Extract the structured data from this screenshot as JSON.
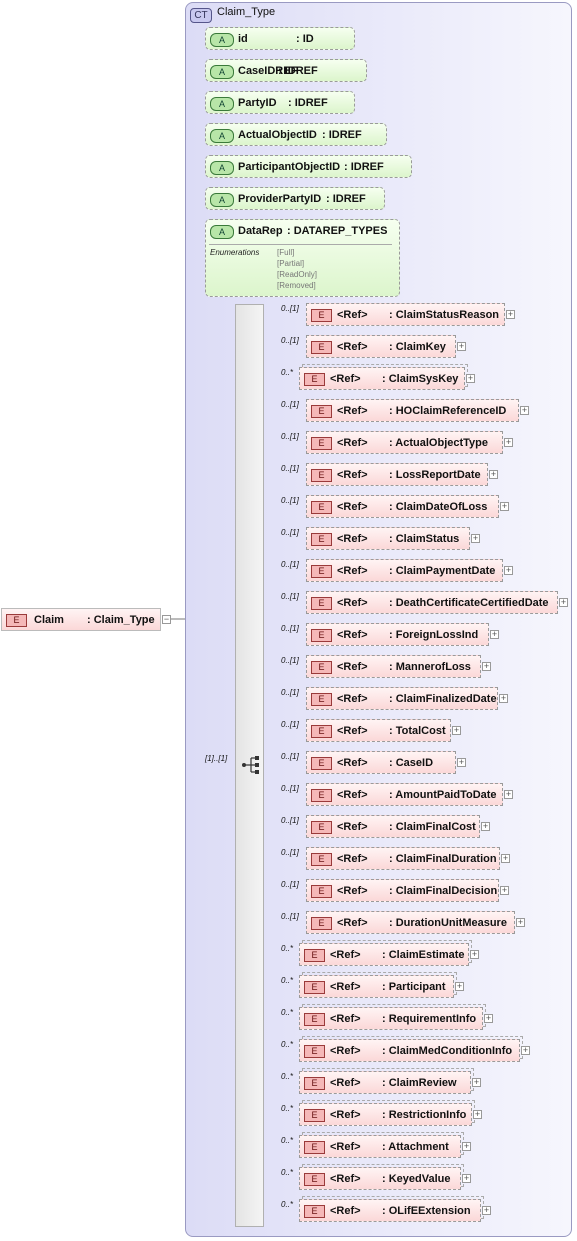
{
  "root_element": {
    "badge": "E",
    "name": "Claim",
    "type": ": Claim_Type"
  },
  "complex_type": {
    "badge": "CT",
    "name": "Claim_Type"
  },
  "attributes": [
    {
      "badge": "A",
      "name": "id",
      "type": ": ID"
    },
    {
      "badge": "A",
      "name": "CaseIDREF",
      "type": ": IDREF"
    },
    {
      "badge": "A",
      "name": "PartyID",
      "type": ": IDREF"
    },
    {
      "badge": "A",
      "name": "ActualObjectID",
      "type": ": IDREF"
    },
    {
      "badge": "A",
      "name": "ParticipantObjectID",
      "type": ": IDREF"
    },
    {
      "badge": "A",
      "name": "ProviderPartyID",
      "type": ": IDREF"
    },
    {
      "badge": "A",
      "name": "DataRep",
      "type": ": DATAREP_TYPES"
    }
  ],
  "enumerations": {
    "label": "Enumerations",
    "values": [
      "[Full]",
      "[Partial]",
      "[ReadOnly]",
      "[Removed]"
    ]
  },
  "sequence_cardinality": "[1]..[1]",
  "elements": [
    {
      "card": "0..[1]",
      "badge": "E",
      "ref": "<Ref>",
      "type": ": ClaimStatusReason"
    },
    {
      "card": "0..[1]",
      "badge": "E",
      "ref": "<Ref>",
      "type": ": ClaimKey"
    },
    {
      "card": "0..*",
      "badge": "E",
      "ref": "<Ref>",
      "type": ": ClaimSysKey"
    },
    {
      "card": "0..[1]",
      "badge": "E",
      "ref": "<Ref>",
      "type": ": HOClaimReferenceID"
    },
    {
      "card": "0..[1]",
      "badge": "E",
      "ref": "<Ref>",
      "type": ": ActualObjectType"
    },
    {
      "card": "0..[1]",
      "badge": "E",
      "ref": "<Ref>",
      "type": ": LossReportDate"
    },
    {
      "card": "0..[1]",
      "badge": "E",
      "ref": "<Ref>",
      "type": ": ClaimDateOfLoss"
    },
    {
      "card": "0..[1]",
      "badge": "E",
      "ref": "<Ref>",
      "type": ": ClaimStatus"
    },
    {
      "card": "0..[1]",
      "badge": "E",
      "ref": "<Ref>",
      "type": ": ClaimPaymentDate"
    },
    {
      "card": "0..[1]",
      "badge": "E",
      "ref": "<Ref>",
      "type": ": DeathCertificateCertifiedDate"
    },
    {
      "card": "0..[1]",
      "badge": "E",
      "ref": "<Ref>",
      "type": ": ForeignLossInd"
    },
    {
      "card": "0..[1]",
      "badge": "E",
      "ref": "<Ref>",
      "type": ": MannerofLoss"
    },
    {
      "card": "0..[1]",
      "badge": "E",
      "ref": "<Ref>",
      "type": ": ClaimFinalizedDate"
    },
    {
      "card": "0..[1]",
      "badge": "E",
      "ref": "<Ref>",
      "type": ": TotalCost"
    },
    {
      "card": "0..[1]",
      "badge": "E",
      "ref": "<Ref>",
      "type": ": CaseID"
    },
    {
      "card": "0..[1]",
      "badge": "E",
      "ref": "<Ref>",
      "type": ": AmountPaidToDate"
    },
    {
      "card": "0..[1]",
      "badge": "E",
      "ref": "<Ref>",
      "type": ": ClaimFinalCost"
    },
    {
      "card": "0..[1]",
      "badge": "E",
      "ref": "<Ref>",
      "type": ": ClaimFinalDuration"
    },
    {
      "card": "0..[1]",
      "badge": "E",
      "ref": "<Ref>",
      "type": ": ClaimFinalDecision"
    },
    {
      "card": "0..[1]",
      "badge": "E",
      "ref": "<Ref>",
      "type": ": DurationUnitMeasure"
    },
    {
      "card": "0..*",
      "badge": "E",
      "ref": "<Ref>",
      "type": ": ClaimEstimate"
    },
    {
      "card": "0..*",
      "badge": "E",
      "ref": "<Ref>",
      "type": ": Participant"
    },
    {
      "card": "0..*",
      "badge": "E",
      "ref": "<Ref>",
      "type": ": RequirementInfo"
    },
    {
      "card": "0..*",
      "badge": "E",
      "ref": "<Ref>",
      "type": ": ClaimMedConditionInfo"
    },
    {
      "card": "0..*",
      "badge": "E",
      "ref": "<Ref>",
      "type": ": ClaimReview"
    },
    {
      "card": "0..*",
      "badge": "E",
      "ref": "<Ref>",
      "type": ": RestrictionInfo"
    },
    {
      "card": "0..*",
      "badge": "E",
      "ref": "<Ref>",
      "type": ": Attachment"
    },
    {
      "card": "0..*",
      "badge": "E",
      "ref": "<Ref>",
      "type": ": KeyedValue"
    },
    {
      "card": "0..*",
      "badge": "E",
      "ref": "<Ref>",
      "type": ": OLifEExtension"
    }
  ],
  "expand_symbol": "+",
  "collapse_symbol": "−"
}
